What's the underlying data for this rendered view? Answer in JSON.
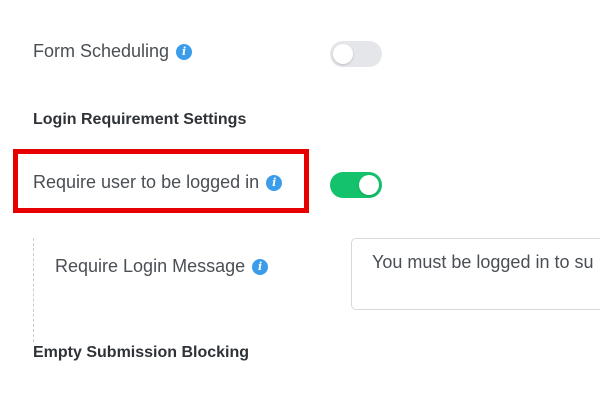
{
  "form_scheduling": {
    "label": "Form Scheduling",
    "enabled": false
  },
  "login_section": {
    "heading": "Login Requirement Settings",
    "require_login": {
      "label": "Require user to be logged in",
      "enabled": true
    },
    "login_message": {
      "label": "Require Login Message",
      "value": "You must be logged in to su"
    }
  },
  "empty_blocking": {
    "heading": "Empty Submission Blocking"
  },
  "icons": {
    "info": "info-icon"
  },
  "colors": {
    "toggle_on": "#13c26b",
    "toggle_off": "#e4e6ea",
    "info_icon": "#3b9dea",
    "highlight": "#e60000"
  }
}
